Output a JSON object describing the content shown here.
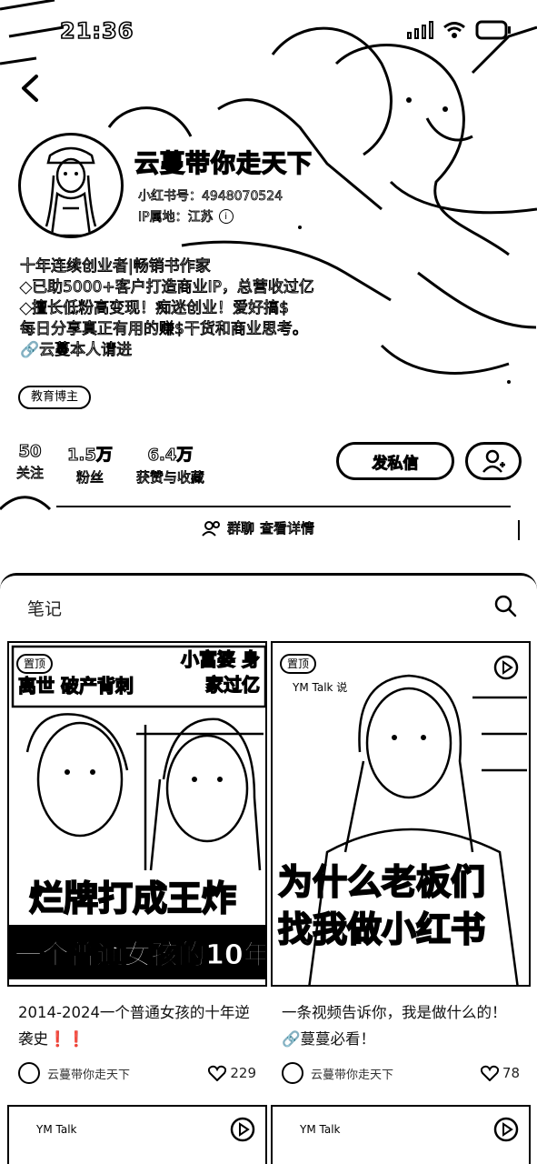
{
  "status_bar": {
    "time": "21:36"
  },
  "profile": {
    "nickname": "云蔓带你走天下",
    "red_id": "小红书号：4948070524",
    "ip_location": "IP属地：江苏",
    "bio": [
      "十年连续创业者|畅销书作家",
      "◆已助5000+客户打造商业IP，总营收过亿",
      "◆擅长低粉高变现！痴迷创业！爱好搞$",
      "每日分享真正有用的赚$干货和商业思考。",
      "🔗云蔓本人请进"
    ],
    "tag": "教育博主",
    "stats": [
      {
        "value": "50",
        "label": "关注"
      },
      {
        "value": "1.5万",
        "label": "粉丝"
      },
      {
        "value": "6.4万",
        "label": "获赞与收藏"
      }
    ],
    "dm_button": "发私信",
    "group_chat": "群聊",
    "view_details": "查看详情"
  },
  "notes_section": {
    "tab_label": "笔记",
    "notes": [
      {
        "pinned": "置顶",
        "cover_text_top_left": "离世 破产背刺",
        "cover_text_top_right": "小富婆 身家过亿",
        "cover_big_text": "烂牌打成王炸",
        "cover_band_text": "一个普通女孩的10年",
        "title": "2014-2024一个普通女孩的十年逆袭史❗️❗️",
        "author": "云蔓带你走天下",
        "likes": "229"
      },
      {
        "pinned": "置顶",
        "cover_small_text": "YM Talk 说",
        "cover_big_line1": "为什么老板们",
        "cover_big_line2": "找我做小红书",
        "title": "一条视频告诉你，我是做什么的！🔗蔓蔓必看！",
        "author": "云蔓带你走天下",
        "likes": "78"
      }
    ],
    "partial_tag": "YM Talk"
  }
}
